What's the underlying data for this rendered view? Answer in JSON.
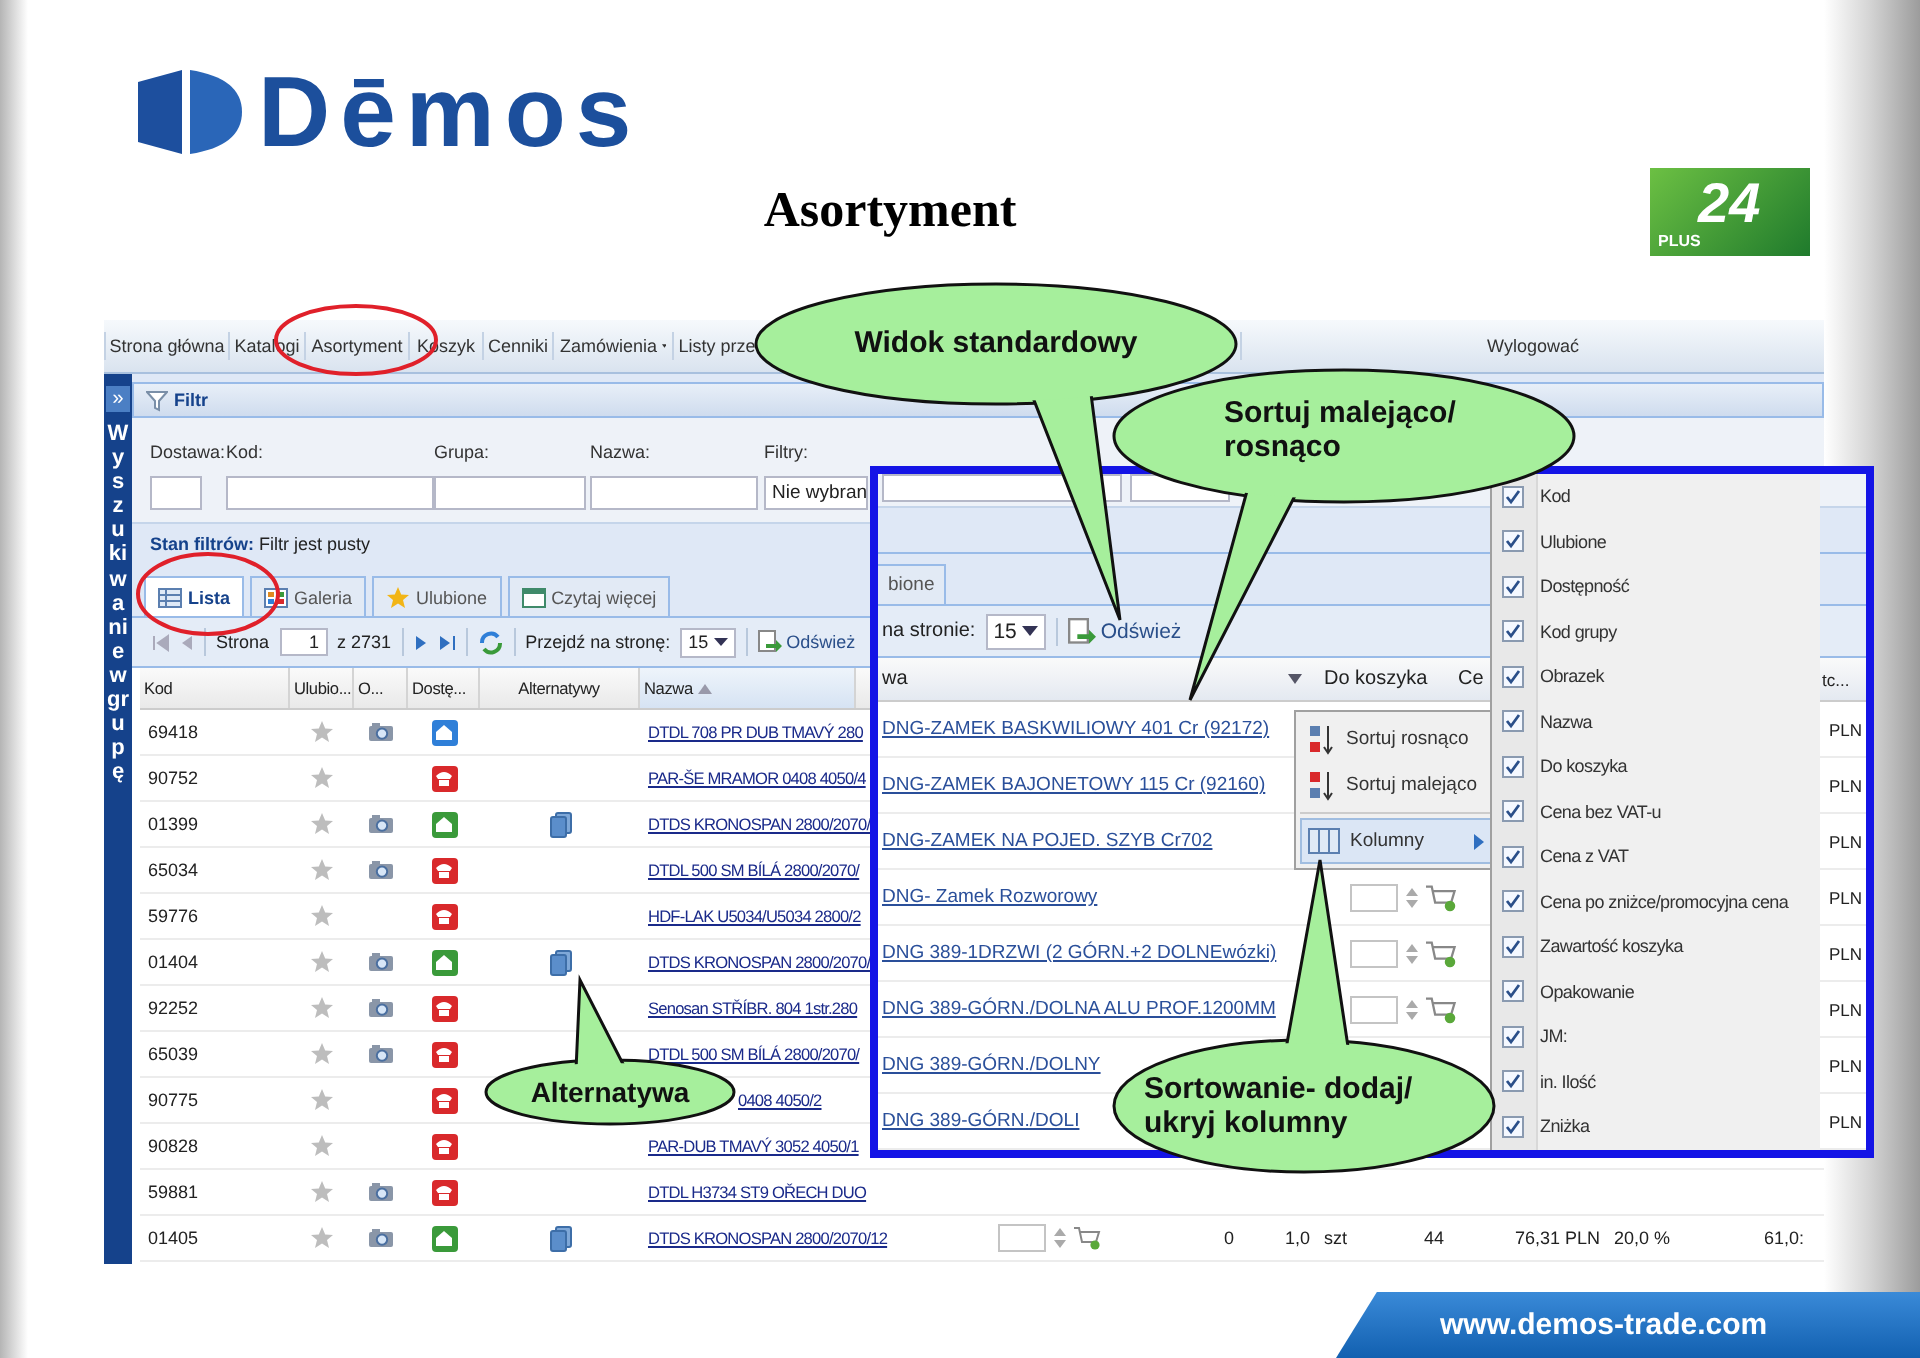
{
  "header": {
    "logo": "Dēmos",
    "title": "Asortyment",
    "badge": {
      "number": "24",
      "label": "PLUS"
    }
  },
  "nav": {
    "items": [
      {
        "label": "Strona główna",
        "has_menu": false
      },
      {
        "label": "Katalogi",
        "has_menu": false
      },
      {
        "label": "Asortyment",
        "has_menu": false
      },
      {
        "label": "Koszyk",
        "has_menu": false
      },
      {
        "label": "Cenniki",
        "has_menu": false
      },
      {
        "label": "Zamówienia",
        "has_menu": true
      },
      {
        "label": "Listy prze",
        "has_menu": false
      },
      {
        "label": "Wylogować",
        "has_menu": false
      }
    ]
  },
  "sidebar": {
    "toggle": "»",
    "label": "Wyszukiwanie w grupę"
  },
  "filter": {
    "title": "Filtr",
    "fields": [
      {
        "label": "Dostawa:"
      },
      {
        "label": "Kod:"
      },
      {
        "label": "Grupa:"
      },
      {
        "label": "Nazwa:"
      },
      {
        "label": "Filtry:",
        "value": "Nie wybran"
      }
    ],
    "status": "**Stan filtrów:** Filtr jest pusty"
  },
  "tabs": [
    {
      "label": "Lista",
      "kind": "list",
      "selected": true
    },
    {
      "label": "Galeria",
      "kind": "gallery",
      "selected": false
    },
    {
      "label": "Ulubione",
      "kind": "favorites",
      "selected": false
    },
    {
      "label": "Czytaj więcej",
      "kind": "details",
      "selected": false
    }
  ],
  "pager": {
    "page_label": "Strona",
    "page": "1",
    "total": "z 2731",
    "goto_label": "Przejdź na stronę:",
    "page_size": "15",
    "refresh": "Odśwież"
  },
  "grid": {
    "columns": [
      {
        "label": "Kod",
        "sorted": false
      },
      {
        "label": "Ulubio...",
        "sorted": false
      },
      {
        "label": "O...",
        "sorted": false
      },
      {
        "label": "Dostę...",
        "sorted": false
      },
      {
        "label": "Alternatywy",
        "sorted": false
      },
      {
        "label": "Nazwa",
        "sorted": true
      }
    ],
    "rows": [
      {
        "code": "69418",
        "photo": true,
        "availability": {
          "kind": "house",
          "color": "#2f7fd8"
        },
        "alternative": false,
        "name": "DTDL 708 PR DUB TMAVÝ 280",
        "partly_covered": false
      },
      {
        "code": "90752",
        "photo": false,
        "availability": {
          "kind": "phone",
          "color": "#d9292b"
        },
        "alternative": false,
        "name": "PAR-ŠE MRAMOR 0408 4050/4",
        "partly_covered": false
      },
      {
        "code": "01399",
        "photo": true,
        "availability": {
          "kind": "house",
          "color": "#3a9a3a"
        },
        "alternative": true,
        "name": "DTDS KRONOSPAN 2800/2070/",
        "partly_covered": false
      },
      {
        "code": "65034",
        "photo": true,
        "availability": {
          "kind": "phone",
          "color": "#d9292b"
        },
        "alternative": false,
        "name": "DTDL 500 SM BÍLÁ 2800/2070/",
        "partly_covered": false
      },
      {
        "code": "59776",
        "photo": false,
        "availability": {
          "kind": "phone",
          "color": "#d9292b"
        },
        "alternative": false,
        "name": "HDF-LAK U5034/U5034 2800/2",
        "partly_covered": false
      },
      {
        "code": "01404",
        "photo": true,
        "availability": {
          "kind": "house",
          "color": "#3a9a3a"
        },
        "alternative": true,
        "name": "DTDS KRONOSPAN 2800/2070/",
        "partly_covered": false
      },
      {
        "code": "92252",
        "photo": true,
        "availability": {
          "kind": "phone",
          "color": "#d9292b"
        },
        "alternative": false,
        "name": "Senosan STŘÍBR. 804 1str.280",
        "partly_covered": false
      },
      {
        "code": "65039",
        "photo": true,
        "availability": {
          "kind": "phone",
          "color": "#d9292b"
        },
        "alternative": false,
        "name": "DTDL 500 SM BÍLÁ 2800/2070/",
        "partly_covered": false
      },
      {
        "code": "90775",
        "photo": false,
        "availability": {
          "kind": "phone",
          "color": "#d9292b"
        },
        "alternative": false,
        "name": "0408 4050/2",
        "partly_covered": true
      },
      {
        "code": "90828",
        "photo": false,
        "availability": {
          "kind": "phone",
          "color": "#d9292b"
        },
        "alternative": false,
        "name": "PAR-DUB TMAVÝ 3052 4050/1",
        "partly_covered": false
      },
      {
        "code": "59881",
        "photo": true,
        "availability": {
          "kind": "phone",
          "color": "#d9292b"
        },
        "alternative": false,
        "name": "DTDL H3734 ST9 OŘECH DUO",
        "partly_covered": false
      },
      {
        "code": "01405",
        "photo": true,
        "availability": {
          "kind": "house",
          "color": "#3a9a3a"
        },
        "alternative": true,
        "name": "DTDS KRONOSPAN 2800/2070/12",
        "partly_covered": false,
        "tail": [
          "0",
          "1,0",
          "szt",
          "44",
          "76,31 PLN",
          "20,0 %",
          "61,0:"
        ]
      }
    ]
  },
  "zoom": {
    "tab": "bione",
    "pager": {
      "goto_label": "na stronie:",
      "page_size": "15",
      "refresh": "Odśwież"
    },
    "columns": [
      "wa",
      "Do koszyka",
      "Ce",
      "tc..."
    ],
    "rows": [
      {
        "name": "DNG-ZAMEK BASKWILIOWY 401 Cr (92172)",
        "kind": "plain",
        "price": "PLN"
      },
      {
        "name": "DNG-ZAMEK BAJONETOWY 115 Cr (92160)",
        "kind": "plain",
        "price": "PLN"
      },
      {
        "name": "DNG-ZAMEK NA POJED. SZYB Cr702",
        "kind": "plain",
        "price": "PLN"
      },
      {
        "name": "DNG- Zamek Rozworowy",
        "kind": "cart",
        "price": "PLN"
      },
      {
        "name": "DNG 389-1DRZWI (2 GÓRN.+2 DOLNEwózki)",
        "kind": "cart",
        "price": "PLN"
      },
      {
        "name": "DNG 389-GÓRN./DOLNA ALU PROF.1200MM",
        "kind": "cart",
        "price": "PLN"
      },
      {
        "name": "DNG 389-GÓRN./DOLNY",
        "kind": "plain",
        "price": "PLN"
      },
      {
        "name": "DNG 389-GÓRN./DOLI",
        "kind": "plain",
        "price": "PLN"
      }
    ],
    "sort_menu": [
      {
        "label": "Sortuj rosnąco",
        "kind": "sort-asc",
        "selected": false
      },
      {
        "label": "Sortuj malejąco",
        "kind": "sort-desc",
        "selected": false
      },
      {
        "label": "Kolumny",
        "kind": "columns",
        "selected": true
      }
    ],
    "column_menu": [
      {
        "label": "Kod",
        "checked": true
      },
      {
        "label": "Ulubione",
        "checked": true
      },
      {
        "label": "Dostępność",
        "checked": true
      },
      {
        "label": "Kod grupy",
        "checked": true
      },
      {
        "label": "Obrazek",
        "checked": true
      },
      {
        "label": "Nazwa",
        "checked": true
      },
      {
        "label": "Do koszyka",
        "checked": true
      },
      {
        "label": "Cena bez VAT-u",
        "checked": true
      },
      {
        "label": "Cena z VAT",
        "checked": true
      },
      {
        "label": "Cena po zniżce/promocyjna cena",
        "checked": true
      },
      {
        "label": "Zawartość koszyka",
        "checked": true
      },
      {
        "label": "Opakowanie",
        "checked": true
      },
      {
        "label": "JM:",
        "checked": true
      },
      {
        "label": "in. Ilość",
        "checked": true
      },
      {
        "label": "Zniżka",
        "checked": true
      }
    ]
  },
  "callouts": [
    {
      "text": "Widok standardowy"
    },
    {
      "text": "Sortuj malejąco/ rosnąco"
    },
    {
      "text": "Alternatywa"
    },
    {
      "text": "Sortowanie- dodaj/ ukryj kolumny"
    }
  ],
  "footer": {
    "url": "www.demos-trade.com"
  }
}
